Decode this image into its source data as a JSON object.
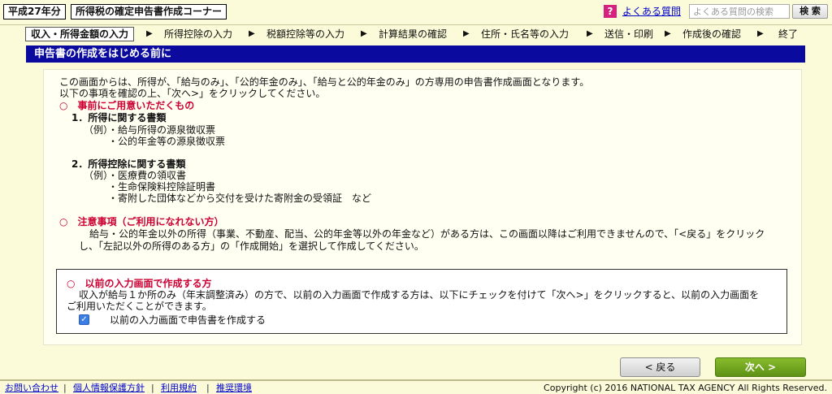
{
  "topbar": {
    "year": "平成27年分",
    "corner_title": "所得税の確定申告書作成コーナー",
    "help_icon_glyph": "?",
    "faq_link": "よくある質問",
    "search_placeholder": "よくある質問の検索",
    "search_button": "検 索"
  },
  "steps": [
    {
      "label": "収入・所得金額の入力"
    },
    {
      "label": "所得控除の入力"
    },
    {
      "label": "税額控除等の入力"
    },
    {
      "label": "計算結果の確認"
    },
    {
      "label": "住所・氏名等の入力"
    },
    {
      "label": "送信・印刷"
    },
    {
      "label": "作成後の確認"
    },
    {
      "label": "終了"
    }
  ],
  "step_arrow": "▶",
  "section_title": "申告書の作成をはじめる前に",
  "intro": {
    "line1": "この画面からは、所得が、「給与のみ」、「公的年金のみ」、「給与と公的年金のみ」の方専用の申告書作成画面となります。",
    "line2": "以下の事項を確認の上、「次へ>」をクリックしてください。"
  },
  "prepare": {
    "heading": "○　事前にご用意いただくもの",
    "item1_title": "1．所得に関する書類",
    "item1_lines": [
      "（例）・給与所得の源泉徴収票",
      "・公的年金等の源泉徴収票"
    ],
    "item2_title": "2．所得控除に関する書類",
    "item2_lines": [
      "（例）・医療費の領収書",
      "・生命保険料控除証明書",
      "・寄附した団体などから交付を受けた寄附金の受領証　など"
    ]
  },
  "caution": {
    "heading": "○　注意事項（ご利用になれない方）",
    "line1": "給与・公的年金以外の所得（事業、不動産、配当、公的年金等以外の年金など）がある方は、この画面以降はご利用できませんので、「<戻る」をクリック",
    "line2": "し、「左記以外の所得のある方」の「作成開始」を選択して作成してください。"
  },
  "previous_screen": {
    "heading": "○　以前の入力画面で作成する方",
    "line1": "収入が給与１か所のみ（年末調整済み）の方で、以前の入力画面で作成する方は、以下にチェックを付けて「次へ>」をクリックすると、以前の入力画面を",
    "line2": "ご利用いただくことができます。",
    "checkbox_label": "以前の入力画面で申告書を作成する",
    "checkbox_checked": true
  },
  "buttons": {
    "back": "< 戻る",
    "next": "次へ >"
  },
  "footer": {
    "links": [
      "お問い合わせ",
      "個人情報保護方針",
      "利用規約",
      "推奨環境"
    ],
    "separator": "|",
    "copyright": "Copyright (c) 2016 NATIONAL TAX AGENCY All Rights Reserved."
  },
  "colors": {
    "page_background": "#fbfbd9",
    "header_bar": "#0a0a9e",
    "heading_red": "#cc0033",
    "next_button_green": "#6fa41e",
    "link_blue": "#0000cc"
  }
}
